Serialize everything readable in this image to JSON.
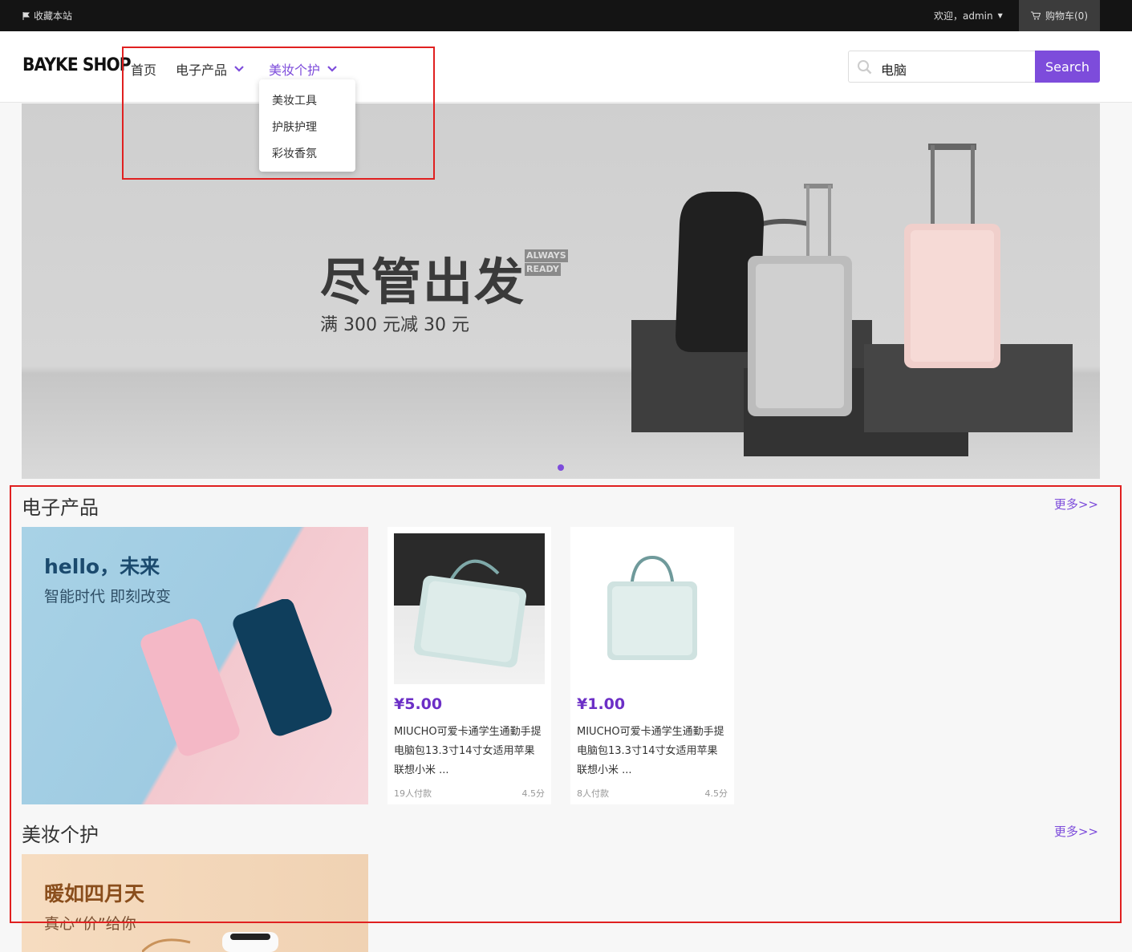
{
  "topbar": {
    "bookmark_label": "收藏本站",
    "welcome_label": "欢迎，admin",
    "cart_label": "购物车(0)"
  },
  "header": {
    "logo": "BAYKE SHOP",
    "nav": [
      {
        "label": "首页"
      },
      {
        "label": "电子产品"
      },
      {
        "label": "美妆个护"
      }
    ],
    "dropdown": [
      "美妆工具",
      "护肤护理",
      "彩妆香氛"
    ],
    "search": {
      "value": "电脑",
      "button": "Search"
    }
  },
  "banner": {
    "title": "尽管出发",
    "badge_1": "ALWAYS",
    "badge_2": "READY",
    "subtitle": "满 300 元减 30 元"
  },
  "sections": [
    {
      "title": "电子产品",
      "more": "更多>>",
      "promo": {
        "headline": "hello，未来",
        "subline": "智能时代 即刻改变"
      },
      "products": [
        {
          "price": "¥5.00",
          "name": "MIUCHO可爱卡通学生通勤手提电脑包13.3寸14寸女适用苹果联想小米 ...",
          "paid": "19人付款",
          "score": "4.5分"
        },
        {
          "price": "¥1.00",
          "name": "MIUCHO可爱卡通学生通勤手提电脑包13.3寸14寸女适用苹果联想小米 ...",
          "paid": "8人付款",
          "score": "4.5分"
        }
      ]
    },
    {
      "title": "美妆个护",
      "more": "更多>>",
      "promo": {
        "headline": "暖如四月天",
        "subline": "真心“价”给你"
      }
    }
  ],
  "colors": {
    "accent": "#7d4cdb",
    "price": "#6c2fc6",
    "topbar": "#141414",
    "annotation": "#e02020"
  }
}
